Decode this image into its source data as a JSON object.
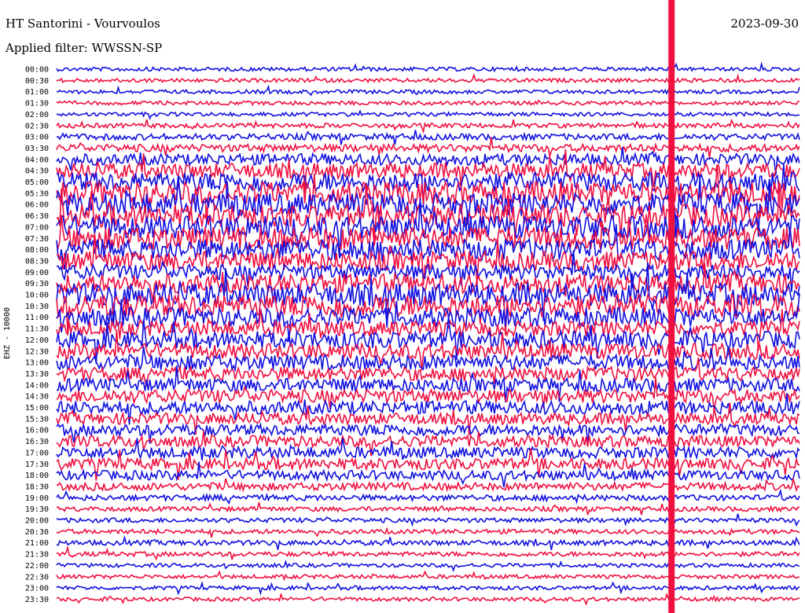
{
  "header": {
    "station": "HT Santorini - Vourvoulos",
    "date": "2023-09-30",
    "filter": "Applied filter: WWSSN-SP"
  },
  "channel_label": "EHZ - 10000",
  "colors": {
    "trace_a": "#1010e0",
    "trace_b": "#f01040",
    "background": "#ffffff",
    "text": "#000000"
  },
  "chart_data": {
    "type": "helicorder",
    "title": "HT Santorini - Vourvoulos",
    "ylabel": "EHZ - 10000",
    "row_labels": [
      "00:00",
      "00:30",
      "01:00",
      "01:30",
      "02:00",
      "02:30",
      "03:00",
      "03:30",
      "04:00",
      "04:30",
      "05:00",
      "05:30",
      "06:00",
      "06:30",
      "07:00",
      "07:30",
      "08:00",
      "08:30",
      "09:00",
      "09:30",
      "10:00",
      "10:30",
      "11:00",
      "11:30",
      "12:00",
      "12:30",
      "13:00",
      "13:30",
      "14:00",
      "14:30",
      "15:00",
      "15:30",
      "16:00",
      "16:30",
      "17:00",
      "17:30",
      "18:00",
      "18:30",
      "19:00",
      "19:30",
      "20:00",
      "20:30",
      "21:00",
      "21:30",
      "22:00",
      "22:30",
      "23:00",
      "23:30"
    ],
    "row_minutes": 30,
    "relative_amplitude": [
      1,
      1,
      1,
      1,
      1,
      1.2,
      1.6,
      2,
      3,
      4,
      5,
      6,
      6,
      6,
      6,
      6,
      5.5,
      5,
      4,
      5,
      6,
      6,
      5,
      4,
      4.5,
      4,
      4,
      3.5,
      3.5,
      3.5,
      3.5,
      3,
      3,
      3,
      3,
      3,
      2.5,
      2,
      1.5,
      1.2,
      1.2,
      1.2,
      1.3,
      1.2,
      1,
      1,
      1,
      1
    ],
    "big_event_minute": 24.8,
    "colors": [
      "blue",
      "red"
    ]
  }
}
